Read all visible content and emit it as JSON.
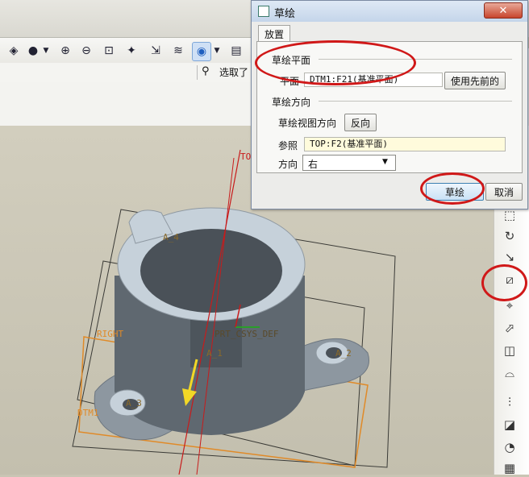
{
  "toolbar": {
    "icons": [
      "shaded-icon",
      "zoom-in-icon",
      "zoom-out-icon",
      "refit-icon",
      "spin-center-icon",
      "named-view-icon",
      "layers-icon",
      "display-style-icon",
      "model-tree-icon"
    ],
    "select_label": "选取了"
  },
  "dialog": {
    "title": "草绘",
    "close_glyph": "✕",
    "tab_label": "放置",
    "sketch_plane_section": "草绘平面",
    "plane_label": "平面",
    "plane_value": "DTM1:F21(基准平面)",
    "use_previous_button": "使用先前的",
    "orientation_section": "草绘方向",
    "view_direction_label": "草绘视图方向",
    "flip_button": "反向",
    "reference_label": "参照",
    "reference_value": "TOP:F2(基准平面)",
    "orientation_label": "方向",
    "orientation_value": "右",
    "sketch_button": "草绘",
    "cancel_button": "取消"
  },
  "model": {
    "labels": {
      "a4": "A_4",
      "a2": "A_2",
      "a3": "A_3",
      "a1": "A_1",
      "right": "RIGHT",
      "top": "TO",
      "dtm1": "DTM1",
      "csys": "PRT_CSYS_DEF"
    }
  },
  "colors": {
    "annotation_red": "#d01818",
    "datum_plane_orange": "#e08a28",
    "part_surface": "#9aa4ad",
    "dialog_bg": "#ececea"
  }
}
